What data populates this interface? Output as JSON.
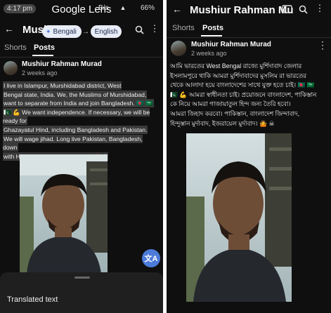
{
  "left": {
    "status": {
      "time": "4:17 pm",
      "net": "B/s",
      "battery": "66%"
    },
    "lens_title": "Google Lens",
    "appbar_title": "Mushi",
    "lang_from": "Bengali",
    "lang_to": "English",
    "tabs": [
      "Shorts",
      "Posts"
    ],
    "author": "Mushiur Rahman Murad",
    "posted": "2 weeks ago",
    "translated": [
      "I live in Islampur, Murshidabad district, West",
      "Bengal state, India. We, the Muslims of Murshidabad,",
      "want to separate from India and join Bangladesh. 🇧🇩 🇸🇦",
      "🇵🇰 💪 We want independence. If necessary, we will be ready for",
      "Ghazayatul Hind, including Bangladesh and Pakistan.",
      "We will wage jihad. Long live Pakistan, Bangladesh, down",
      "with Hindustan, down with Israel. 🤷 ☠"
    ],
    "sheet_label": "Translated text"
  },
  "right": {
    "appbar_title": "Mushiur Rahman Mur…",
    "tabs": [
      "Shorts",
      "Posts"
    ],
    "author": "Mushiur Rahman Murad",
    "posted": "2 weeks ago",
    "bengali": [
      "আমি ভারতের West Bengal রাজ্যে মুর্শিদাবাদ জেলার",
      "ইসলামপুরে থাকি আমরা মুর্শিদাবাদের মুসলিম রা ভারতের",
      "থেকে আলাদা হয়ে বাংলাদেশের সাথে যুক্ত হতে চাই। 🇧🇩 🇸🇦",
      "🇵🇰 💪 আমরা স্বাধীনতা চাই। প্রয়োজনে বাংলাদেশ, পাকিস্তান",
      "কে নিয়ে আমরা গাজায়াতুল হিন্দ জন্য তৈরি হবো।",
      "আমরা জিহাদ করবো। পাকিস্তান, বাংলাদেশ জিন্দাবাদ,",
      "হিন্দুস্তান মুর্দাবাদ, ইজরায়েল মুর্দাবাদ। 🤷 ☠"
    ]
  },
  "icons": {
    "back": "back-arrow-icon",
    "search": "search-icon",
    "more": "more-vertical-icon",
    "cast": "cast-icon",
    "translate_fab": "translate-icon",
    "swap": "arrow-right-icon",
    "sparkle": "sparkle-icon"
  },
  "colors": {
    "background": "#0f0f0f",
    "chip_bg": "#e8ecf7",
    "fab": "#4c7bd9"
  }
}
